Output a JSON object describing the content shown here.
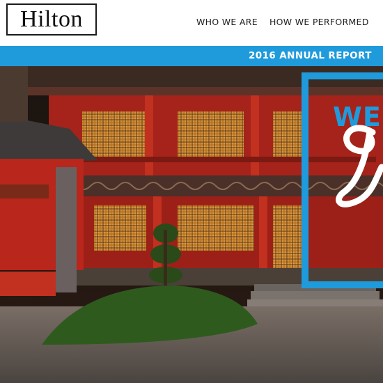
{
  "brand": {
    "logo_text": "Hilton"
  },
  "nav": {
    "items": [
      "WHO WE ARE",
      "HOW WE PERFORMED"
    ]
  },
  "banner": {
    "text": "2016 ANNUAL REPORT"
  },
  "hero": {
    "headline_partial": "WE"
  },
  "colors": {
    "accent": "#1f9bdc",
    "wall_red": "#b8261c",
    "text": "#222222"
  }
}
